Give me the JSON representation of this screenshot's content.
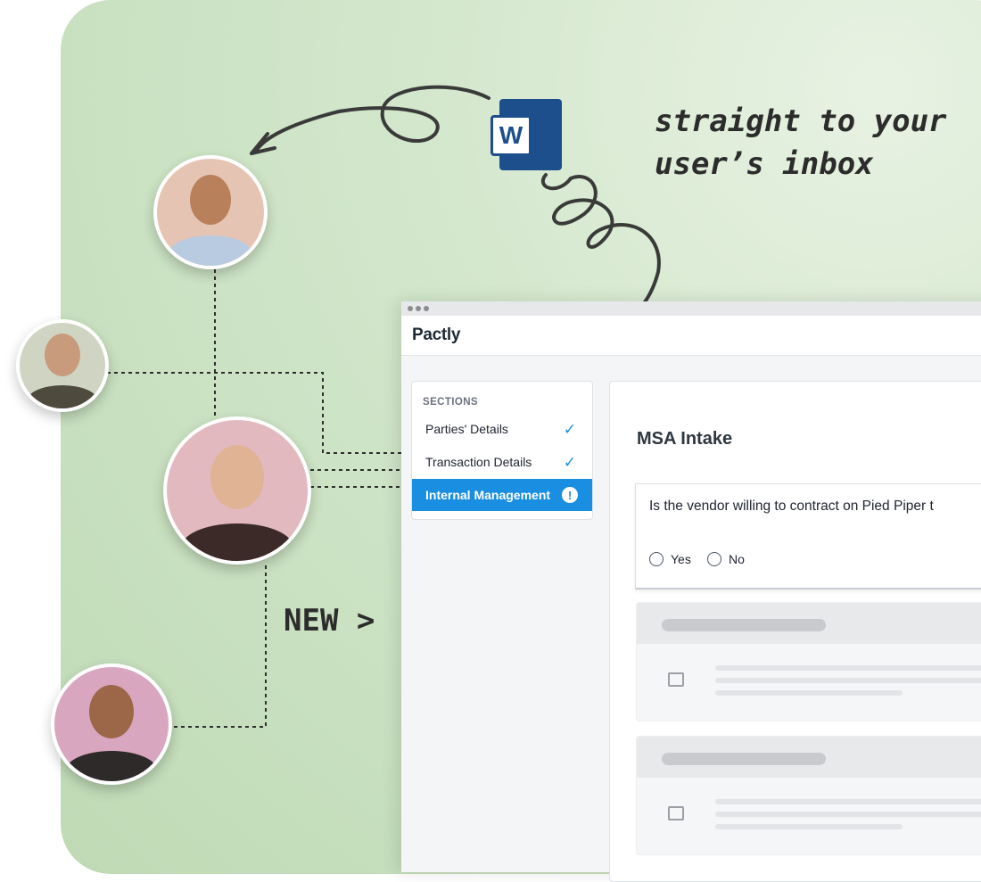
{
  "hero": {
    "tagline_line1": "straight to your",
    "tagline_line2": "user’s inbox",
    "new_label": "NEW >",
    "word_icon_letter": "W"
  },
  "app": {
    "logo": "Pactly",
    "sections": {
      "header": "SECTIONS",
      "items": [
        {
          "label": "Parties' Details",
          "status": "complete"
        },
        {
          "label": "Transaction Details",
          "status": "complete"
        },
        {
          "label": "Internal Management",
          "status": "attention"
        }
      ]
    },
    "form": {
      "title": "MSA Intake",
      "question": "Is the vendor willing to contract on Pied Piper t",
      "options": [
        "Yes",
        "No"
      ]
    }
  },
  "colors": {
    "accent": "#1a8ee0",
    "background_green": "#cfe3c7",
    "word_blue": "#1d4f8c"
  }
}
